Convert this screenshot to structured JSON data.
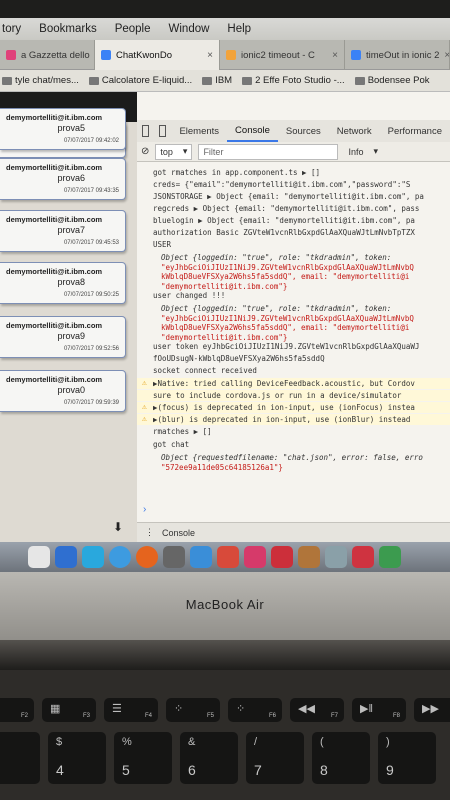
{
  "menubar": [
    "tory",
    "Bookmarks",
    "People",
    "Window",
    "Help"
  ],
  "tabs": [
    {
      "label": "a Gazzetta dello",
      "active": false,
      "color": "#e0417a"
    },
    {
      "label": "ChatKwonDo",
      "active": true,
      "color": "#3b82f6"
    },
    {
      "label": "ionic2 timeout - C",
      "active": false,
      "color": "#f2a33a"
    },
    {
      "label": "timeOut in ionic 2",
      "active": false,
      "color": "#3b82f6"
    }
  ],
  "bookmarks": [
    "tyle chat/mes...",
    "Calcolatore E-liquid...",
    "IBM",
    "2 Effe Foto Studio -...",
    "Bodensee Pok"
  ],
  "messages": [
    {
      "sender": "",
      "text": "prova4",
      "date": "07/07/2017 09:41:09"
    },
    {
      "sender": "demymortelliti@it.ibm.com",
      "text": "prova5",
      "date": "07/07/2017 09:42:02"
    },
    {
      "sender": "demymortelliti@it.ibm.com",
      "text": "prova6",
      "date": "07/07/2017 09:43:35"
    },
    {
      "sender": "demymortelliti@it.ibm.com",
      "text": "prova7",
      "date": "07/07/2017 09:45:53"
    },
    {
      "sender": "demymortelliti@it.ibm.com",
      "text": "prova8",
      "date": "07/07/2017 09:50:25"
    },
    {
      "sender": "demymortelliti@it.ibm.com",
      "text": "prova9",
      "date": "07/07/2017 09:52:56"
    },
    {
      "sender": "demymortelliti@it.ibm.com",
      "text": "prova0",
      "date": "07/07/2017 09:59:39"
    }
  ],
  "devtools": {
    "tabs": [
      "Elements",
      "Console",
      "Sources",
      "Network",
      "Performance"
    ],
    "context": "top",
    "filter_placeholder": "Filter",
    "level": "Info",
    "drawer_label": "Console",
    "lines": [
      {
        "text": "got rmatches in app.component.ts ▶ []",
        "kind": "log"
      },
      {
        "text": "creds= {\"email\":\"demymortelliti@it.ibm.com\",\"password\":\"S",
        "kind": "log"
      },
      {
        "text": "JSONSTORAGE ▶ Object {email: \"demymortelliti@it.ibm.com\", pa",
        "kind": "log"
      },
      {
        "text": "regcreds ▶ Object {email: \"demymortelliti@it.ibm.com\", pass",
        "kind": "log"
      },
      {
        "text": "bluelogin ▶ Object {email: \"demymortelliti@it.ibm.com\", pa",
        "kind": "log"
      },
      {
        "text": "authorization Basic ZGVteW1vcnRlbGxpdGlAaXQuaWJtLmNvbTpTZX",
        "kind": "log"
      },
      {
        "text": "USER",
        "kind": "log"
      },
      {
        "text": "Object {loggedin: \"true\", role: \"tkdradmin\", token:",
        "kind": "obj"
      },
      {
        "text": "\"eyJhbGciOiJIUzI1NiJ9.ZGVteW1vcnRlbGxpdGlAaXQuaWJtLmNvbQ",
        "kind": "str"
      },
      {
        "text": "kWblqD8ueVFSXya2W6hs5fa5sddQ\", email: \"demymortelliti@i",
        "kind": "str"
      },
      {
        "text": "\"demymortelliti@it.ibm.com\"}",
        "kind": "str"
      },
      {
        "text": "user changed !!!",
        "kind": "log"
      },
      {
        "text": "Object {loggedin: \"true\", role: \"tkdradmin\", token:",
        "kind": "obj"
      },
      {
        "text": "\"eyJhbGciOiJIUzI1NiJ9.ZGVteW1vcnRlbGxpdGlAaXQuaWJtLmNvbQ",
        "kind": "str"
      },
      {
        "text": "kWblqD8ueVFSXya2W6hs5fa5sddQ\", email: \"demymortelliti@i",
        "kind": "str"
      },
      {
        "text": "\"demymortelliti@it.ibm.com\"}",
        "kind": "str"
      },
      {
        "text": "user token eyJhbGciOiJIUzI1NiJ9.ZGVteW1vcnRlbGxpdGlAaXQuaWJ",
        "kind": "log"
      },
      {
        "text": "fOoUDsugN-kWblqD8ueVFSXya2W6hs5fa5sddQ",
        "kind": "log"
      },
      {
        "text": "socket connect received",
        "kind": "log"
      },
      {
        "text": "▶Native: tried calling DeviceFeedback.acoustic, but Cordov",
        "kind": "warn"
      },
      {
        "text": " sure to include cordova.js or run in a device/simulator",
        "kind": "warn"
      },
      {
        "text": "▶(focus) is deprecated in ion-input, use (ionFocus) instea",
        "kind": "warn"
      },
      {
        "text": "▶(blur) is deprecated in ion-input, use (ionBlur) instead",
        "kind": "warn"
      },
      {
        "text": "rmatches ▶ []",
        "kind": "log"
      },
      {
        "text": "got chat",
        "kind": "log"
      },
      {
        "text": "Object {requestedfilename: \"chat.json\", error: false, erro",
        "kind": "obj"
      },
      {
        "text": "\"572ee9a11de05c64185126a1\"}",
        "kind": "str"
      }
    ]
  },
  "laptop_label": "MacBook Air",
  "keys_fn": [
    {
      "label": "☀",
      "fn": "F2"
    },
    {
      "label": "▦",
      "fn": "F3"
    },
    {
      "label": "☰",
      "fn": "F4"
    },
    {
      "label": "⁘",
      "fn": "F5"
    },
    {
      "label": "⁘",
      "fn": "F6"
    },
    {
      "label": "◀◀",
      "fn": "F7"
    },
    {
      "label": "▶‖",
      "fn": "F8"
    },
    {
      "label": "▶▶",
      "fn": "F9"
    }
  ],
  "keys_num": [
    {
      "top": "£",
      "bot": "3"
    },
    {
      "top": "$",
      "bot": "4"
    },
    {
      "top": "%",
      "bot": "5"
    },
    {
      "top": "&",
      "bot": "6"
    },
    {
      "top": "/",
      "bot": "7"
    },
    {
      "top": "(",
      "bot": "8"
    },
    {
      "top": ")",
      "bot": "9"
    }
  ],
  "colors": {
    "accent": "#3b78e7",
    "app_border": "#7d8fb5",
    "warn_bg": "#fff8d8",
    "string": "#c41a16"
  }
}
